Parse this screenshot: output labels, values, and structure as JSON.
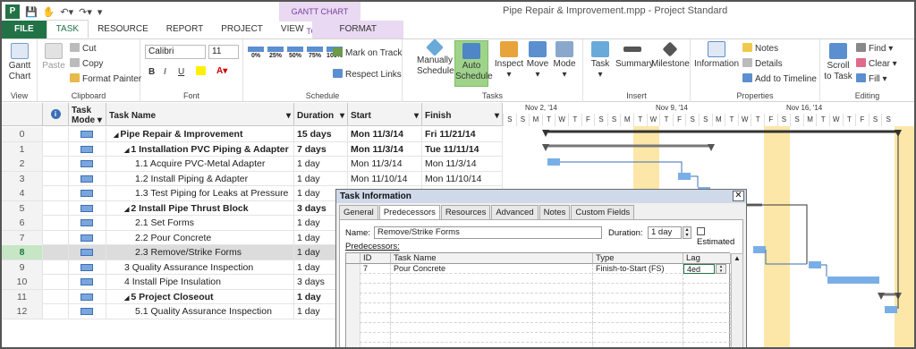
{
  "window": {
    "title": "Pipe Repair & Improvement.mpp - Project Standard",
    "context_tools": "GANTT CHART TOOLS"
  },
  "tabs": {
    "file": "FILE",
    "task": "TASK",
    "resource": "RESOURCE",
    "report": "REPORT",
    "project": "PROJECT",
    "view": "VIEW",
    "format": "FORMAT"
  },
  "ribbon": {
    "view": {
      "gantt": "Gantt",
      "chart": "Chart",
      "label": "View"
    },
    "clipboard": {
      "paste": "Paste",
      "cut": "Cut",
      "copy": "Copy",
      "format_painter": "Format Painter",
      "label": "Clipboard"
    },
    "font": {
      "family": "Calibri",
      "size": "11",
      "bold": "B",
      "italic": "I",
      "underline": "U",
      "label": "Font"
    },
    "schedule": {
      "mark_on_track": "Mark on Track",
      "respect_links": "Respect Links",
      "label": "Schedule",
      "pcts": [
        "0%",
        "25%",
        "50%",
        "75%",
        "100%"
      ]
    },
    "tasks": {
      "manually": "Manually",
      "schedule": "Schedule",
      "auto": "Auto",
      "auto_schedule": "Schedule",
      "inspect": "Inspect",
      "move": "Move",
      "mode": "Mode",
      "label": "Tasks"
    },
    "insert": {
      "task": "Task",
      "summary": "Summary",
      "milestone": "Milestone",
      "label": "Insert"
    },
    "properties": {
      "information": "Information",
      "notes": "Notes",
      "details": "Details",
      "add_to_timeline": "Add to Timeline",
      "label": "Properties"
    },
    "editing": {
      "scroll": "Scroll",
      "to_task": "to Task",
      "find": "Find",
      "clear": "Clear",
      "fill": "Fill",
      "label": "Editing"
    }
  },
  "grid": {
    "headers": {
      "task_mode_1": "Task",
      "task_mode_2": "Mode",
      "task_name": "Task Name",
      "duration": "Duration",
      "start": "Start",
      "finish": "Finish"
    },
    "rows": [
      {
        "id": "0",
        "name": "Pipe Repair & Improvement",
        "duration": "15 days",
        "start": "Mon 11/3/14",
        "finish": "Fri 11/21/14"
      },
      {
        "id": "1",
        "name": "1 Installation PVC Piping & Adapter",
        "duration": "7 days",
        "start": "Mon 11/3/14",
        "finish": "Tue 11/11/14"
      },
      {
        "id": "2",
        "name": "1.1 Acquire PVC-Metal Adapter",
        "duration": "1 day",
        "start": "Mon 11/3/14",
        "finish": "Mon 11/3/14"
      },
      {
        "id": "3",
        "name": "1.2 Install Piping & Adapter",
        "duration": "1 day",
        "start": "Mon 11/10/14",
        "finish": "Mon 11/10/14"
      },
      {
        "id": "4",
        "name": "1.3 Test Piping for Leaks at Pressure",
        "duration": "1 day",
        "start": "",
        "finish": ""
      },
      {
        "id": "5",
        "name": "2 Install Pipe Thrust Block",
        "duration": "3 days",
        "start": "",
        "finish": ""
      },
      {
        "id": "6",
        "name": "2.1 Set Forms",
        "duration": "1 day",
        "start": "",
        "finish": ""
      },
      {
        "id": "7",
        "name": "2.2 Pour Concrete",
        "duration": "1 day",
        "start": "",
        "finish": ""
      },
      {
        "id": "8",
        "name": "2.3 Remove/Strike Forms",
        "duration": "1 day",
        "start": "",
        "finish": ""
      },
      {
        "id": "9",
        "name": "3 Quality Assurance Inspection",
        "duration": "1 day",
        "start": "",
        "finish": ""
      },
      {
        "id": "10",
        "name": "4 Install Pipe Insulation",
        "duration": "3 days",
        "start": "",
        "finish": ""
      },
      {
        "id": "11",
        "name": "5 Project Closeout",
        "duration": "1 day",
        "start": "",
        "finish": ""
      },
      {
        "id": "12",
        "name": "5.1 Quality Assurance Inspection",
        "duration": "1 day",
        "start": "",
        "finish": ""
      }
    ]
  },
  "gantt": {
    "weeks": [
      "Nov 2, '14",
      "Nov 9, '14",
      "Nov 16, '14"
    ],
    "days": [
      "S",
      "S",
      "M",
      "T",
      "W",
      "T",
      "F",
      "S",
      "S",
      "M",
      "T",
      "W",
      "T",
      "F",
      "S",
      "S",
      "M",
      "T",
      "W",
      "T",
      "F",
      "S",
      "S",
      "M",
      "T",
      "W",
      "T",
      "F",
      "S",
      "S"
    ]
  },
  "dialog": {
    "title": "Task Information",
    "close": "✕",
    "tabs": [
      "General",
      "Predecessors",
      "Resources",
      "Advanced",
      "Notes",
      "Custom Fields"
    ],
    "name_label": "Name:",
    "name_value": "Remove/Strike Forms",
    "duration_label": "Duration:",
    "duration_value": "1 day",
    "estimated": "Estimated",
    "predecessors_label": "Predecessors:",
    "cols": {
      "id": "ID",
      "task_name": "Task Name",
      "type": "Type",
      "lag": "Lag"
    },
    "row": {
      "id": "7",
      "task_name": "Pour Concrete",
      "type": "Finish-to-Start (FS)",
      "lag": "4ed"
    }
  },
  "colors": {
    "accent": "#217346",
    "bar": "#7aaee6",
    "weekend": "#fce7a8"
  }
}
